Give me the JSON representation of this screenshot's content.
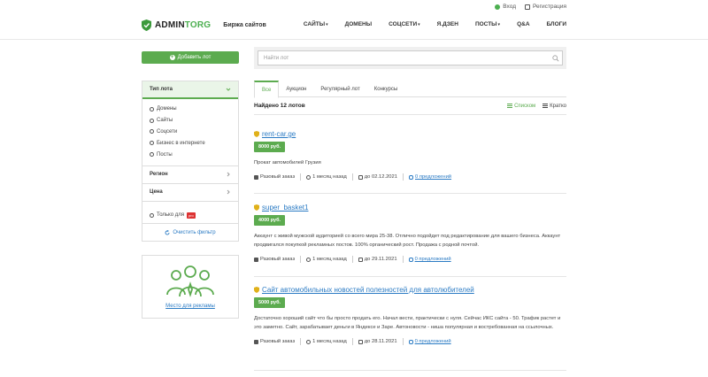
{
  "topbar": {
    "login": "Вход",
    "register": "Регистрация"
  },
  "header": {
    "brand_a": "ADMIN",
    "brand_b": "TORG",
    "tagline": "Биржа сайтов",
    "nav": [
      "САЙТЫ",
      "ДОМЕНЫ",
      "СОЦСЕТИ",
      "Я.ДЗЕН",
      "ПОСТЫ",
      "Q&A",
      "БЛОГИ"
    ]
  },
  "sidebar": {
    "add_lot": "Добавить лот",
    "filter_title": "Тип лота",
    "types": [
      "Домены",
      "Сайты",
      "Соцсети",
      "Бизнес в интернете",
      "Посты"
    ],
    "region": "Регион",
    "price": "Цена",
    "only_label": "Только для",
    "only_badge": "pro",
    "clear": "Очистить фильтр",
    "ad_link": "Место для рекламы"
  },
  "search": {
    "placeholder": "Найти лот"
  },
  "tabs": [
    "Все",
    "Аукцион",
    "Регулярный лот",
    "Конкурсы"
  ],
  "found": "Найдено 12 лотов",
  "view": {
    "list": "Списком",
    "brief": "Кратко"
  },
  "lots": [
    {
      "title": "rent-car.ge",
      "price": "8000 руб.",
      "desc": "Прокат автомобилей Грузия",
      "type": "Разовый заказ",
      "ago": "1 месяц назад",
      "until": "до 02.12.2021",
      "offers": "0 предложений"
    },
    {
      "title": "super_basket1",
      "price": "4000 руб.",
      "desc": "Аккаунт с живой мужской аудиторией со всего мира 25-38. Отлично подойдет под редактирование для вашего бизнеса. Аккаунт продвигался покупкой рекламных постов. 100% органический рост. Продажа с родной почтой.",
      "type": "Разовый заказ",
      "ago": "1 месяц назад",
      "until": "до 29.11.2021",
      "offers": "0 предложений"
    },
    {
      "title": "Сайт автомобильных новостей полезностей для автолюбителей",
      "price": "5000 руб.",
      "desc": "Достаточно хороший сайт что бы просто продать его. Начал вести, практически с нуля. Сейчас ИКС сайта - 50. Трафик растет и это заметно. Сайт, зарабатывает деньги в Яндексе и Заре. Автоновости - ниша популярная и востребованная на ссылочных.",
      "type": "Разовый заказ",
      "ago": "1 месяц назад",
      "until": "до 28.11.2021",
      "offers": "0 предложений"
    }
  ],
  "colors": {
    "accent": "#5cab4f",
    "link": "#2b7bc4"
  }
}
